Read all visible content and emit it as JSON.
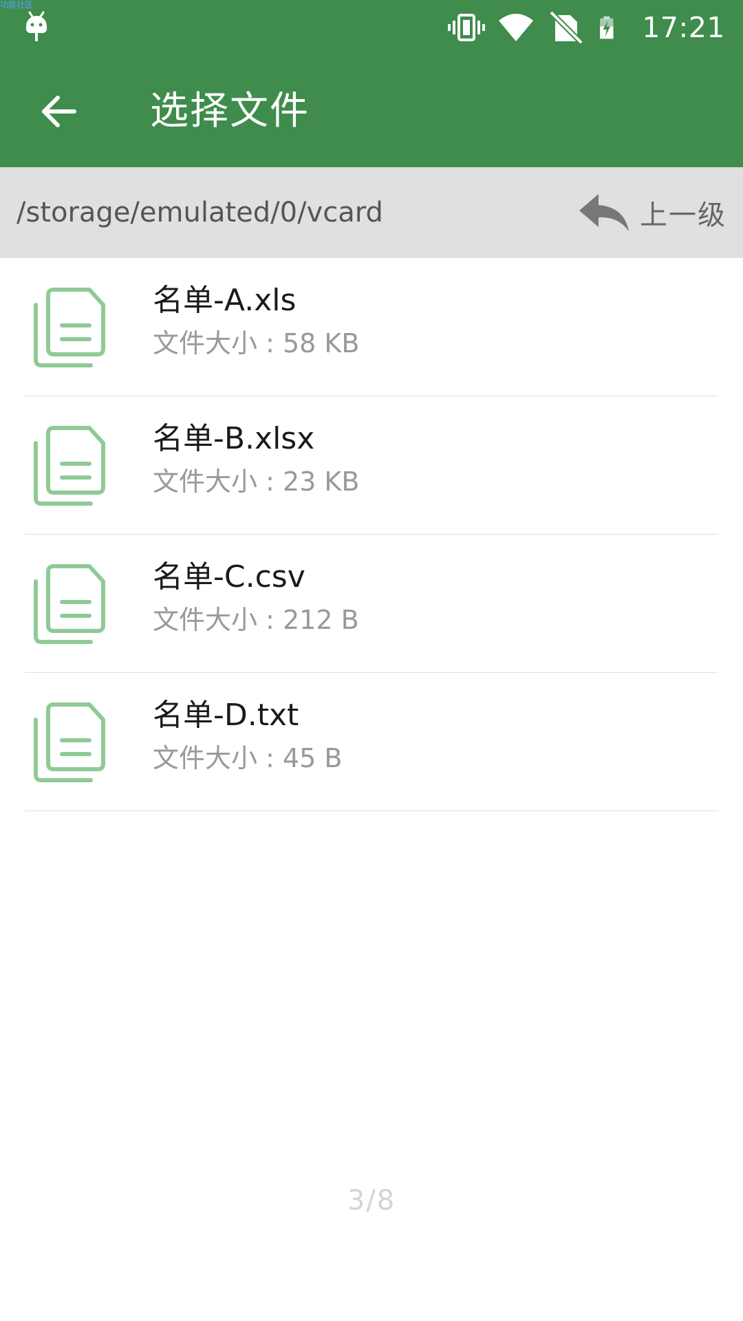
{
  "status_bar": {
    "watermark": "功能社区",
    "time": "17:21",
    "icons": [
      "android-debug-icon",
      "vibrate-icon",
      "wifi-icon",
      "no-sim-icon",
      "battery-charging-icon"
    ]
  },
  "app_bar": {
    "back_icon": "arrow-left-icon",
    "title": "选择文件"
  },
  "path_bar": {
    "path": "/storage/emulated/0/vcard",
    "up_icon": "reply-arrow-icon",
    "up_label": "上一级"
  },
  "files": [
    {
      "name": "名单-A.xls",
      "size": "文件大小 : 58 KB",
      "icon": "file-copy-icon"
    },
    {
      "name": "名单-B.xlsx",
      "size": "文件大小 : 23 KB",
      "icon": "file-copy-icon"
    },
    {
      "name": "名单-C.csv",
      "size": "文件大小 : 212 B",
      "icon": "file-copy-icon"
    },
    {
      "name": "名单-D.txt",
      "size": "文件大小 : 45 B",
      "icon": "file-copy-icon"
    }
  ],
  "page_indicator": "3/8",
  "colors": {
    "primary": "#3f8c4d",
    "path_bar_bg": "#e0e0e0",
    "file_icon": "#8fca96",
    "secondary_text": "#999999"
  }
}
